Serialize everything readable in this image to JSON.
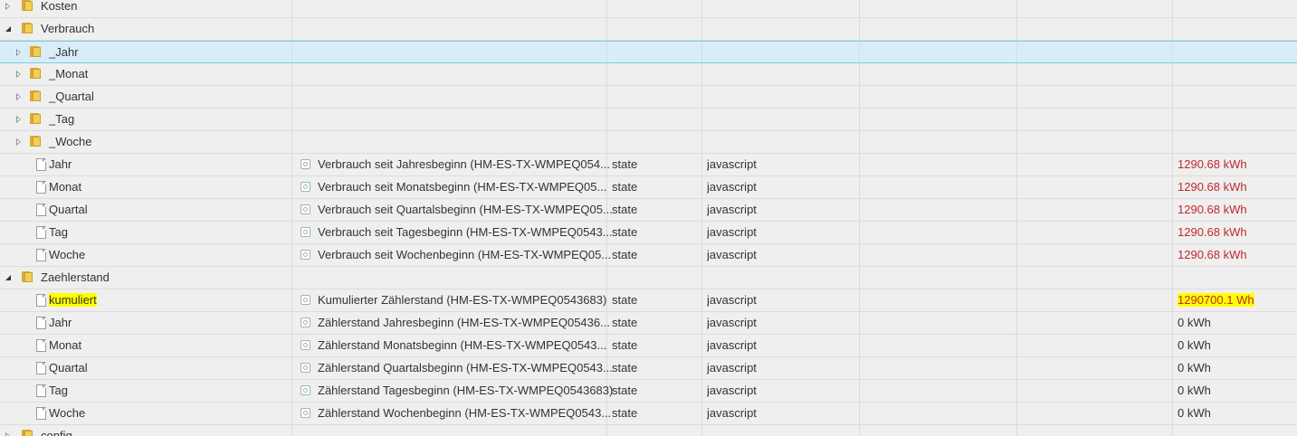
{
  "colors": {
    "background": "#efefef",
    "selected_row": "#d7eef8",
    "selected_border": "#7cc8e6",
    "value_red": "#c0282d",
    "highlight": "#ffff00",
    "folder": "#f1cf56"
  },
  "rows": [
    {
      "name": "Kosten",
      "kind": "folder",
      "expander": "closed",
      "indent": 0,
      "desc": "",
      "type": "",
      "role": "",
      "value": "",
      "value_color": "",
      "highlight_name": false,
      "highlight_value": false,
      "selected": false,
      "icon": "folder-icon"
    },
    {
      "name": "Verbrauch",
      "kind": "folder",
      "expander": "open",
      "indent": 0,
      "desc": "",
      "type": "",
      "role": "",
      "value": "",
      "value_color": "",
      "highlight_name": false,
      "highlight_value": false,
      "selected": false,
      "icon": "folder-open-icon"
    },
    {
      "name": "_Jahr",
      "kind": "folder",
      "expander": "closed",
      "indent": 1,
      "desc": "",
      "type": "",
      "role": "",
      "value": "",
      "value_color": "",
      "highlight_name": false,
      "highlight_value": false,
      "selected": true,
      "icon": "folder-icon"
    },
    {
      "name": "_Monat",
      "kind": "folder",
      "expander": "closed",
      "indent": 1,
      "desc": "",
      "type": "",
      "role": "",
      "value": "",
      "value_color": "",
      "highlight_name": false,
      "highlight_value": false,
      "selected": false,
      "icon": "folder-icon"
    },
    {
      "name": "_Quartal",
      "kind": "folder",
      "expander": "closed",
      "indent": 1,
      "desc": "",
      "type": "",
      "role": "",
      "value": "",
      "value_color": "",
      "highlight_name": false,
      "highlight_value": false,
      "selected": false,
      "icon": "folder-icon"
    },
    {
      "name": "_Tag",
      "kind": "folder",
      "expander": "closed",
      "indent": 1,
      "desc": "",
      "type": "",
      "role": "",
      "value": "",
      "value_color": "",
      "highlight_name": false,
      "highlight_value": false,
      "selected": false,
      "icon": "folder-icon"
    },
    {
      "name": "_Woche",
      "kind": "folder",
      "expander": "closed",
      "indent": 1,
      "desc": "",
      "type": "",
      "role": "",
      "value": "",
      "value_color": "",
      "highlight_name": false,
      "highlight_value": false,
      "selected": false,
      "icon": "folder-icon"
    },
    {
      "name": "Jahr",
      "kind": "state",
      "expander": "none",
      "indent": 1,
      "desc": "Verbrauch seit Jahresbeginn (HM-ES-TX-WMPEQ054...",
      "type": "state",
      "role": "javascript",
      "value": "1290.68 kWh",
      "value_color": "#c0282d",
      "highlight_name": false,
      "highlight_value": false,
      "selected": false,
      "icon": "document-icon"
    },
    {
      "name": "Monat",
      "kind": "state",
      "expander": "none",
      "indent": 1,
      "desc": "Verbrauch seit Monatsbeginn (HM-ES-TX-WMPEQ05...",
      "type": "state",
      "role": "javascript",
      "value": "1290.68 kWh",
      "value_color": "#c0282d",
      "highlight_name": false,
      "highlight_value": false,
      "selected": false,
      "icon": "document-icon"
    },
    {
      "name": "Quartal",
      "kind": "state",
      "expander": "none",
      "indent": 1,
      "desc": "Verbrauch seit Quartalsbeginn (HM-ES-TX-WMPEQ05...",
      "type": "state",
      "role": "javascript",
      "value": "1290.68 kWh",
      "value_color": "#c0282d",
      "highlight_name": false,
      "highlight_value": false,
      "selected": false,
      "icon": "document-icon"
    },
    {
      "name": "Tag",
      "kind": "state",
      "expander": "none",
      "indent": 1,
      "desc": "Verbrauch seit Tagesbeginn (HM-ES-TX-WMPEQ0543...",
      "type": "state",
      "role": "javascript",
      "value": "1290.68 kWh",
      "value_color": "#c0282d",
      "highlight_name": false,
      "highlight_value": false,
      "selected": false,
      "icon": "document-icon"
    },
    {
      "name": "Woche",
      "kind": "state",
      "expander": "none",
      "indent": 1,
      "desc": "Verbrauch seit Wochenbeginn (HM-ES-TX-WMPEQ05...",
      "type": "state",
      "role": "javascript",
      "value": "1290.68 kWh",
      "value_color": "#c0282d",
      "highlight_name": false,
      "highlight_value": false,
      "selected": false,
      "icon": "document-icon"
    },
    {
      "name": "Zaehlerstand",
      "kind": "folder",
      "expander": "open",
      "indent": 0,
      "desc": "",
      "type": "",
      "role": "",
      "value": "",
      "value_color": "",
      "highlight_name": false,
      "highlight_value": false,
      "selected": false,
      "icon": "folder-open-icon"
    },
    {
      "name": "kumuliert",
      "kind": "state",
      "expander": "none",
      "indent": 1,
      "desc": "Kumulierter Zählerstand (HM-ES-TX-WMPEQ0543683)",
      "type": "state",
      "role": "javascript",
      "value": "1290700.1 Wh",
      "value_color": "#c0282d",
      "highlight_name": true,
      "highlight_value": true,
      "selected": false,
      "icon": "document-icon"
    },
    {
      "name": "Jahr",
      "kind": "state",
      "expander": "none",
      "indent": 1,
      "desc": "Zählerstand Jahresbeginn (HM-ES-TX-WMPEQ05436...",
      "type": "state",
      "role": "javascript",
      "value": "0 kWh",
      "value_color": "#333333",
      "highlight_name": false,
      "highlight_value": false,
      "selected": false,
      "icon": "document-icon"
    },
    {
      "name": "Monat",
      "kind": "state",
      "expander": "none",
      "indent": 1,
      "desc": "Zählerstand Monatsbeginn (HM-ES-TX-WMPEQ0543...",
      "type": "state",
      "role": "javascript",
      "value": "0 kWh",
      "value_color": "#333333",
      "highlight_name": false,
      "highlight_value": false,
      "selected": false,
      "icon": "document-icon"
    },
    {
      "name": "Quartal",
      "kind": "state",
      "expander": "none",
      "indent": 1,
      "desc": "Zählerstand Quartalsbeginn (HM-ES-TX-WMPEQ0543...",
      "type": "state",
      "role": "javascript",
      "value": "0 kWh",
      "value_color": "#333333",
      "highlight_name": false,
      "highlight_value": false,
      "selected": false,
      "icon": "document-icon"
    },
    {
      "name": "Tag",
      "kind": "state",
      "expander": "none",
      "indent": 1,
      "desc": "Zählerstand Tagesbeginn (HM-ES-TX-WMPEQ0543683)",
      "type": "state",
      "role": "javascript",
      "value": "0 kWh",
      "value_color": "#333333",
      "highlight_name": false,
      "highlight_value": false,
      "selected": false,
      "icon": "document-icon"
    },
    {
      "name": "Woche",
      "kind": "state",
      "expander": "none",
      "indent": 1,
      "desc": "Zählerstand Wochenbeginn (HM-ES-TX-WMPEQ0543...",
      "type": "state",
      "role": "javascript",
      "value": "0 kWh",
      "value_color": "#333333",
      "highlight_name": false,
      "highlight_value": false,
      "selected": false,
      "icon": "document-icon"
    },
    {
      "name": "config",
      "kind": "folder",
      "expander": "closed",
      "indent": 0,
      "desc": "",
      "type": "",
      "role": "",
      "value": "",
      "value_color": "",
      "highlight_name": false,
      "highlight_value": false,
      "selected": false,
      "icon": "folder-icon"
    }
  ]
}
